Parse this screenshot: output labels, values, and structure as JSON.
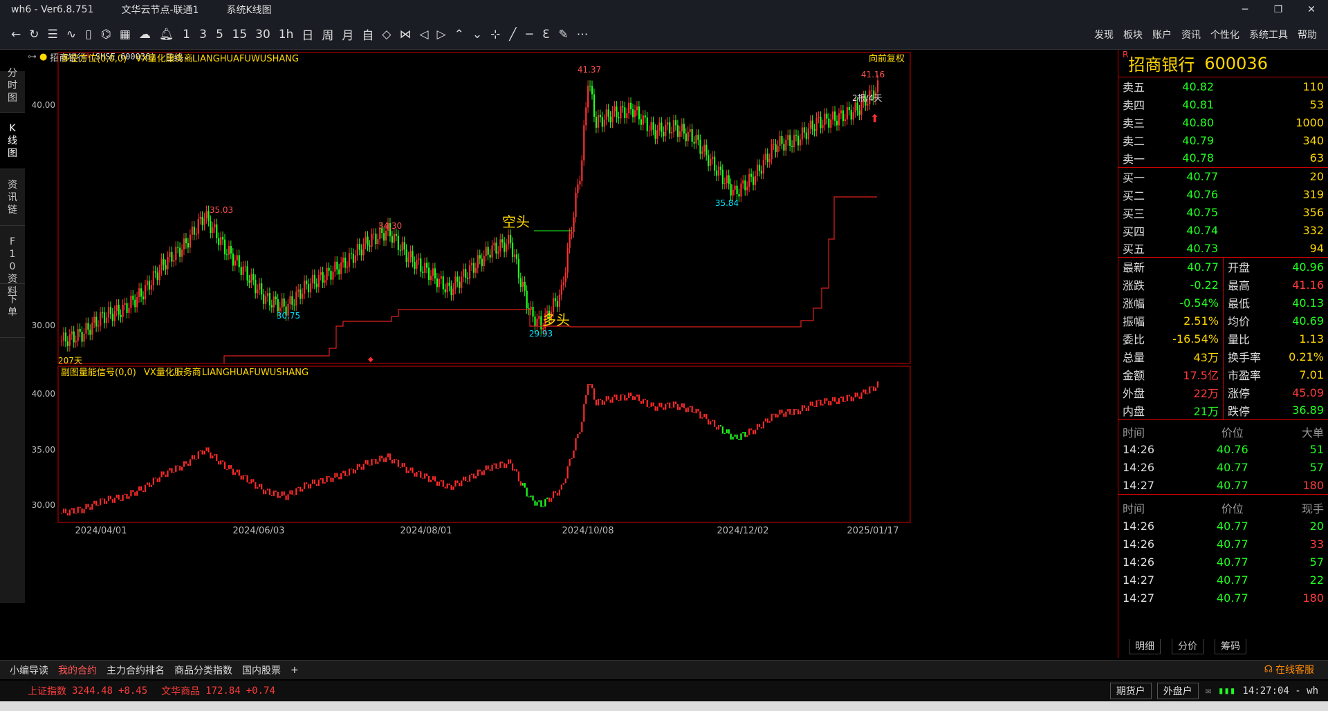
{
  "titlebar": {
    "app": "wh6 - Ver6.8.751",
    "node": "文华云节点-联通1",
    "view": "系统K线图"
  },
  "toolbar": {
    "menu": [
      "发现",
      "板块",
      "账户",
      "资讯",
      "个性化",
      "系统工具",
      "帮助"
    ],
    "periods": [
      "1",
      "3",
      "5",
      "15",
      "30",
      "1h",
      "日",
      "周",
      "月",
      "自"
    ]
  },
  "left_tabs": [
    "分时图",
    "K线图",
    "资讯链",
    "F10资料",
    "下单"
  ],
  "chart_header": {
    "name": "招商银行",
    "code": "(SHSE 600036)",
    "period": "日线",
    "adjust": "向前复权"
  },
  "main_indicator": {
    "name": "多空方位(0,0,0)",
    "vendor": "VX量化服务商",
    "vendor_id": "LIANGHUAFUWUSHANG"
  },
  "sub_indicator": {
    "name": "副图量能信号(0,0)",
    "vendor": "VX量化服务商",
    "vendor_id": "LIANGHUAFUWUSHANG"
  },
  "annotations": {
    "short_label": "空头",
    "long_label": "多头",
    "bars_info": "2根/4天",
    "bars207": "207天"
  },
  "price_labels": {
    "p1": "35.03",
    "p2": "30.75",
    "p3": "34.30",
    "p4": "29.93",
    "p5": "41.37",
    "p6": "35.84",
    "p7": "41.16"
  },
  "axis": {
    "main_y": [
      "40.00",
      "30.00"
    ],
    "sub_y": [
      "40.00",
      "35.00",
      "30.00"
    ],
    "x": [
      "2024/04/01",
      "2024/06/03",
      "2024/08/01",
      "2024/10/08",
      "2024/12/02",
      "2025/01/17"
    ]
  },
  "quote": {
    "title": "招商银行",
    "code": "600036",
    "asks": [
      {
        "l": "卖五",
        "p": "40.82",
        "v": "110"
      },
      {
        "l": "卖四",
        "p": "40.81",
        "v": "53"
      },
      {
        "l": "卖三",
        "p": "40.80",
        "v": "1000"
      },
      {
        "l": "卖二",
        "p": "40.79",
        "v": "340"
      },
      {
        "l": "卖一",
        "p": "40.78",
        "v": "63"
      }
    ],
    "bids": [
      {
        "l": "买一",
        "p": "40.77",
        "v": "20"
      },
      {
        "l": "买二",
        "p": "40.76",
        "v": "319"
      },
      {
        "l": "买三",
        "p": "40.75",
        "v": "356"
      },
      {
        "l": "买四",
        "p": "40.74",
        "v": "332"
      },
      {
        "l": "买五",
        "p": "40.73",
        "v": "94"
      }
    ],
    "stats": [
      {
        "a": "最新",
        "av": "40.77",
        "ac": "g",
        "b": "开盘",
        "bv": "40.96",
        "bc": "g"
      },
      {
        "a": "涨跌",
        "av": "-0.22",
        "ac": "g",
        "b": "最高",
        "bv": "41.16",
        "bc": "r"
      },
      {
        "a": "涨幅",
        "av": "-0.54%",
        "ac": "g",
        "b": "最低",
        "bv": "40.13",
        "bc": "g"
      },
      {
        "a": "振幅",
        "av": "2.51%",
        "ac": "y",
        "b": "均价",
        "bv": "40.69",
        "bc": "g"
      },
      {
        "a": "委比",
        "av": "-16.54%",
        "ac": "y",
        "b": "量比",
        "bv": "1.13",
        "bc": "y"
      },
      {
        "a": "总量",
        "av": "43万",
        "ac": "y",
        "b": "换手率",
        "bv": "0.21%",
        "bc": "y"
      },
      {
        "a": "金额",
        "av": "17.5亿",
        "ac": "r",
        "b": "市盈率",
        "bv": "7.01",
        "bc": "y"
      },
      {
        "a": "外盘",
        "av": "22万",
        "ac": "r",
        "b": "涨停",
        "bv": "45.09",
        "bc": "r"
      },
      {
        "a": "内盘",
        "av": "21万",
        "ac": "g",
        "b": "跌停",
        "bv": "36.89",
        "bc": "g"
      }
    ],
    "tick1": {
      "h": [
        "时间",
        "价位",
        "大单"
      ],
      "rows": [
        [
          "14:26",
          "40.76",
          "51"
        ],
        [
          "14:26",
          "40.77",
          "57"
        ],
        [
          "14:27",
          "40.77",
          "180"
        ]
      ]
    },
    "tick2": {
      "h": [
        "时间",
        "价位",
        "现手"
      ],
      "rows": [
        [
          "14:26",
          "40.77",
          "20"
        ],
        [
          "14:26",
          "40.77",
          "33"
        ],
        [
          "14:26",
          "40.77",
          "57"
        ],
        [
          "14:27",
          "40.77",
          "22"
        ],
        [
          "14:27",
          "40.77",
          "180"
        ]
      ]
    },
    "tabs": [
      "明细",
      "分价",
      "筹码"
    ]
  },
  "bottom_tabs": [
    "小编导读",
    "我的合约",
    "主力合约排名",
    "商品分类指数",
    "国内股票",
    "+"
  ],
  "status": {
    "idx1": "上证指数",
    "idx1v": "3244.48",
    "idx1c": "+8.45",
    "idx2": "文华商品",
    "idx2v": "172.84",
    "idx2c": "+0.74",
    "b1": "期货户",
    "b2": "外盘户",
    "time": "14:27:04 - wh",
    "service": "在线客服"
  },
  "chart_data": {
    "type": "candlestick",
    "series": [
      {
        "name": "招商银行",
        "values": [
          [
            0,
            29.3
          ],
          [
            10,
            29.6
          ],
          [
            20,
            30.4
          ],
          [
            30,
            30.7
          ],
          [
            40,
            31.5
          ],
          [
            50,
            32.8
          ],
          [
            60,
            33.6
          ],
          [
            70,
            35.0
          ],
          [
            80,
            33.5
          ],
          [
            90,
            32.4
          ],
          [
            100,
            31.2
          ],
          [
            110,
            30.8
          ],
          [
            120,
            31.8
          ],
          [
            130,
            32.3
          ],
          [
            140,
            32.9
          ],
          [
            150,
            33.8
          ],
          [
            160,
            34.3
          ],
          [
            170,
            33.1
          ],
          [
            180,
            32.4
          ],
          [
            190,
            31.6
          ],
          [
            200,
            32.5
          ],
          [
            210,
            33.4
          ],
          [
            220,
            33.8
          ],
          [
            225,
            32.0
          ],
          [
            230,
            30.5
          ],
          [
            235,
            30.0
          ],
          [
            245,
            31.5
          ],
          [
            250,
            34.5
          ],
          [
            255,
            37.5
          ],
          [
            258,
            41.2
          ],
          [
            262,
            39.2
          ],
          [
            270,
            39.6
          ],
          [
            280,
            39.8
          ],
          [
            290,
            38.8
          ],
          [
            300,
            39.0
          ],
          [
            310,
            38.5
          ],
          [
            320,
            37.2
          ],
          [
            330,
            36.0
          ],
          [
            340,
            36.8
          ],
          [
            350,
            38.2
          ],
          [
            360,
            38.4
          ],
          [
            370,
            39.2
          ],
          [
            380,
            39.4
          ],
          [
            390,
            39.8
          ],
          [
            400,
            40.77
          ]
        ]
      }
    ]
  }
}
